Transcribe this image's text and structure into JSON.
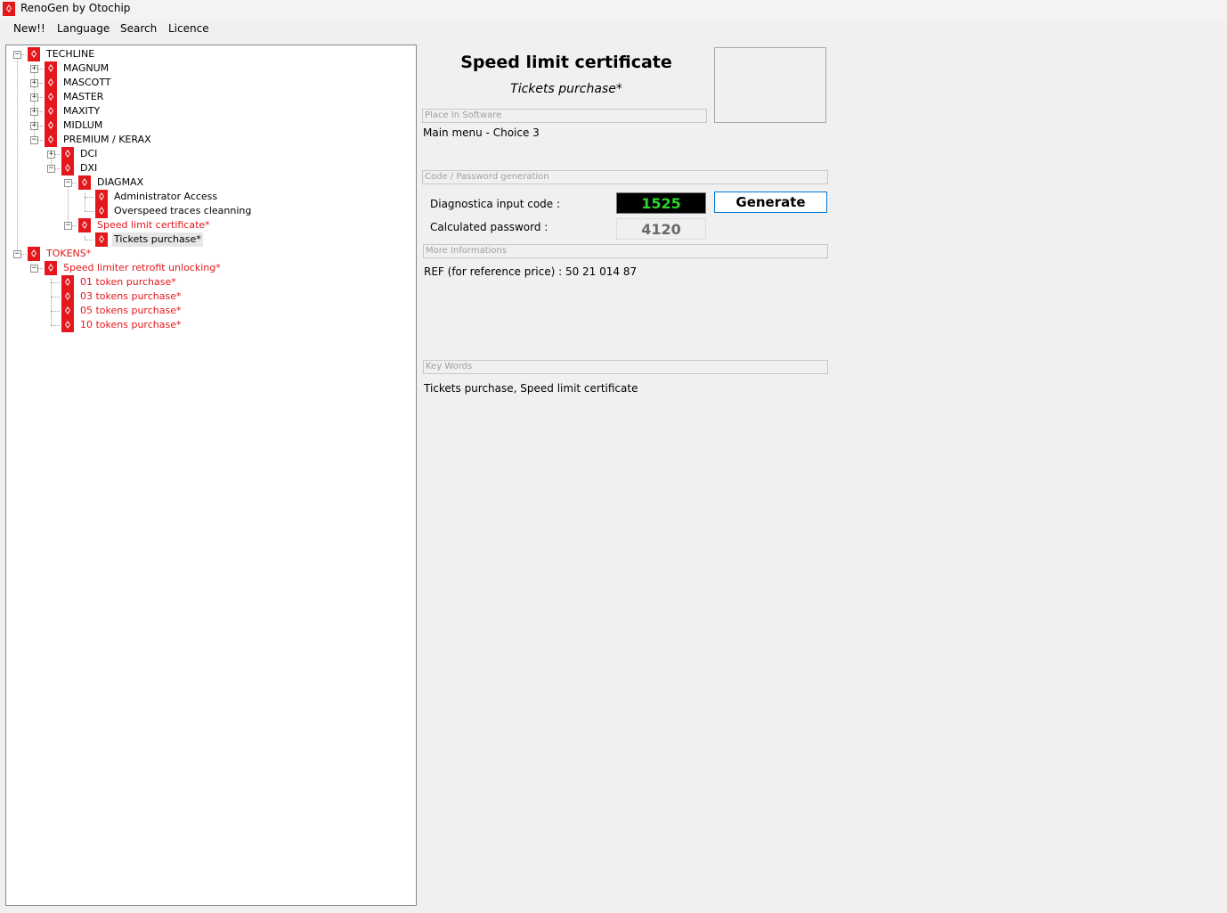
{
  "window": {
    "title": "RenoGen by Otochip",
    "icon": "renault-logo-icon"
  },
  "menu": [
    "New!!",
    "Language",
    "Search",
    "Licence"
  ],
  "tree": {
    "techline": "TECHLINE",
    "magnum": "MAGNUM",
    "mascott": "MASCOTT",
    "master": "MASTER",
    "maxity": "MAXITY",
    "midlum": "MIDLUM",
    "premium": "PREMIUM / KERAX",
    "dci": "DCI",
    "dxi": "DXI",
    "diagmax": "DIAGMAX",
    "admin": "Administrator Access",
    "overspeed": "Overspeed traces cleanning",
    "speed_cert": "Speed limit certificate*",
    "tickets": "Tickets purchase*",
    "tokens": "TOKENS*",
    "retrofit": "Speed limiter retrofit unlocking*",
    "t01": "01 token purchase*",
    "t03": "03 tokens purchase*",
    "t05": "05 tokens purchase*",
    "t10": "10 tokens purchase*"
  },
  "detail": {
    "title": "Speed limit certificate",
    "subtitle": "Tickets purchase*",
    "place_hdr": "Place In Software",
    "place_val": "Main menu - Choice 3",
    "code_hdr": "Code / Password generation",
    "input_label": "Diagnostica input code :",
    "input_code": "1525",
    "password_label": "Calculated password :",
    "password": "4120",
    "generate": "Generate",
    "more_hdr": "More Informations",
    "ref": "REF (for reference price) : 50 21 014 87",
    "keywords_hdr": "Key Words",
    "keywords": "Tickets purchase, Speed limit certificate"
  },
  "colors": {
    "accent_red": "#e3171c",
    "code_green": "#2bd62b",
    "focus_blue": "#0078d7"
  }
}
